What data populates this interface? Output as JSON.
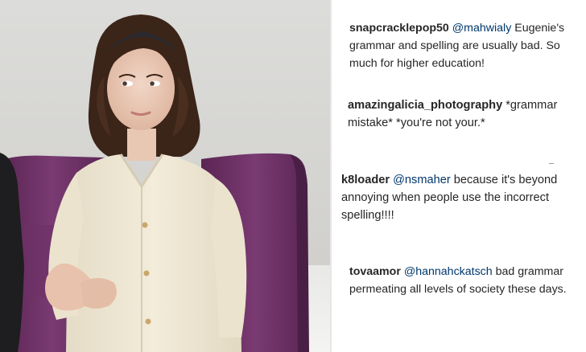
{
  "comments": [
    {
      "username": "snapcracklepop50",
      "mention": "@mahwialy",
      "text": " Eugenie's grammar and spelling are usually bad. So much for higher education!"
    },
    {
      "username": "amazingalicia_photography",
      "mention": "",
      "text": " *grammar mistake* *you're not your.*"
    },
    {
      "username": "k8loader",
      "mention": "@nsmaher",
      "text": " because it's beyond annoying when people use the incorrect spelling!!!!"
    },
    {
      "username": "tovaamor",
      "mention": "@hannahckatsch",
      "text": " bad grammar permeating all levels of society these days."
    }
  ],
  "colors": {
    "username": "#262626",
    "mention": "#00376b",
    "text": "#262626",
    "jacket": "#efe7d3",
    "chair": "#6b2f63",
    "background": "#d6d6d3"
  },
  "icons": {
    "photo": "woman-in-cream-jacket-photo"
  }
}
